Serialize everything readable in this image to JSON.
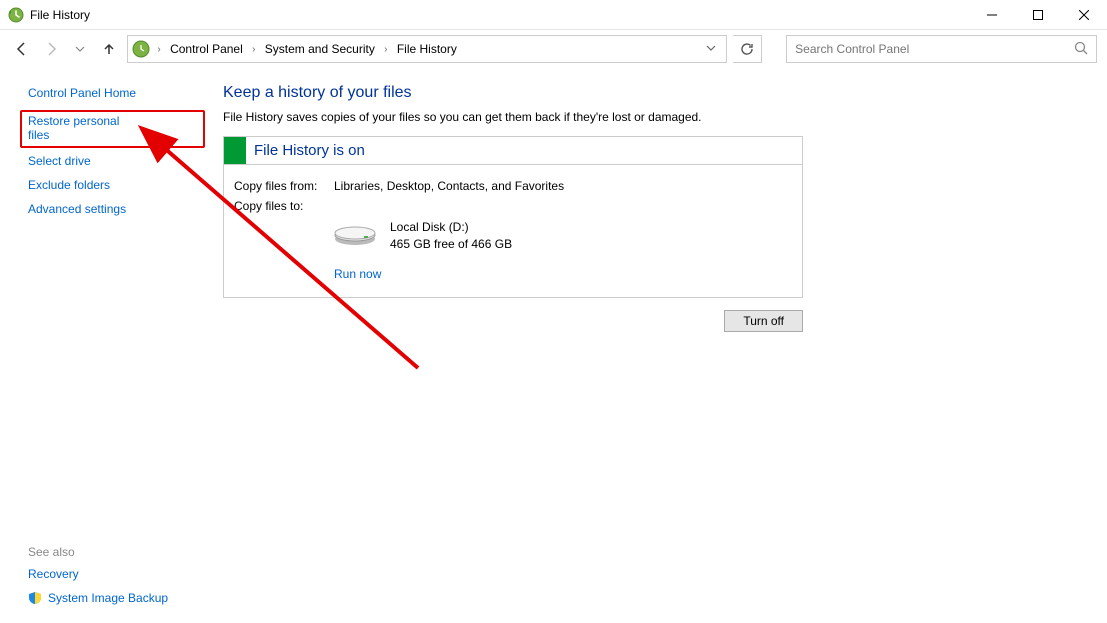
{
  "window": {
    "title": "File History"
  },
  "breadcrumbs": {
    "b0": "Control Panel",
    "b1": "System and Security",
    "b2": "File History"
  },
  "search": {
    "placeholder": "Search Control Panel"
  },
  "sidebar": {
    "home": "Control Panel Home",
    "restore": "Restore personal files",
    "select_drive": "Select drive",
    "exclude": "Exclude folders",
    "advanced": "Advanced settings",
    "see_also": "See also",
    "recovery": "Recovery",
    "sys_image": "System Image Backup"
  },
  "main": {
    "title": "Keep a history of your files",
    "desc": "File History saves copies of your files so you can get them back if they're lost or damaged.",
    "status_header": "File History is on",
    "copy_from_label": "Copy files from:",
    "copy_from_value": "Libraries, Desktop, Contacts, and Favorites",
    "copy_to_label": "Copy files to:",
    "drive_name": "Local Disk (D:)",
    "drive_space": "465 GB free of 466 GB",
    "run_now": "Run now",
    "turn_off": "Turn off"
  }
}
